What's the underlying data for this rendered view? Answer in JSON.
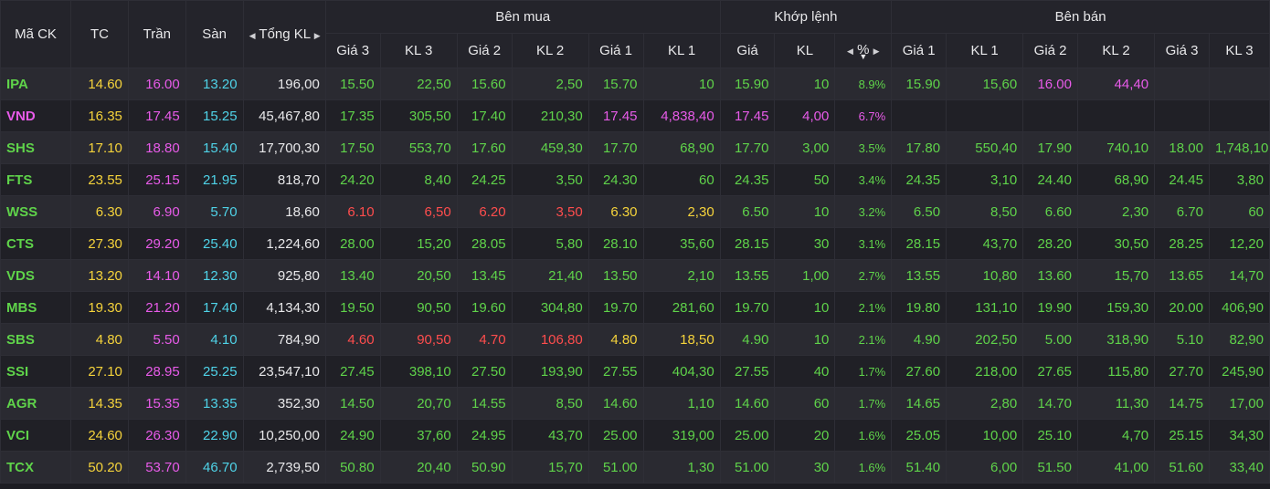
{
  "header": {
    "symbol": "Mã CK",
    "ref": "TC",
    "ceil": "Trần",
    "floor": "Sàn",
    "total_vol": "Tổng KL",
    "buy_group": "Bên mua",
    "match_group": "Khớp lệnh",
    "sell_group": "Bên bán",
    "buy_cols": [
      "Giá 3",
      "KL 3",
      "Giá 2",
      "KL 2",
      "Giá 1",
      "KL 1"
    ],
    "match_cols": [
      "Giá",
      "KL",
      "%"
    ],
    "sell_cols": [
      "Giá 1",
      "KL 1",
      "Giá 2",
      "KL 2",
      "Giá 3",
      "KL 3"
    ]
  },
  "colors": {
    "up": "#5fd34a",
    "down": "#ff4d4d",
    "ref": "#f5d33b",
    "ceil": "#e85be9",
    "floor": "#4fd3e8",
    "neutral": "#e8e8ea"
  },
  "rows": [
    {
      "s": "IPA",
      "tc": "14.60",
      "tran": "16.00",
      "san": "13.20",
      "tkl": "196,00",
      "cells": [
        [
          "15.50",
          "up"
        ],
        [
          "22,50",
          "up"
        ],
        [
          "15.60",
          "up"
        ],
        [
          "2,50",
          "up"
        ],
        [
          "15.70",
          "up"
        ],
        [
          "10",
          "up"
        ],
        [
          "15.90",
          "up"
        ],
        [
          "10",
          "up"
        ],
        [
          "8.9%",
          "up"
        ],
        [
          "15.90",
          "up"
        ],
        [
          "15,60",
          "up"
        ],
        [
          "16.00",
          "ceil"
        ],
        [
          "44,40",
          "ceil"
        ],
        [
          "",
          ""
        ],
        [
          "",
          ""
        ]
      ],
      "sc": "up"
    },
    {
      "s": "VND",
      "tc": "16.35",
      "tran": "17.45",
      "san": "15.25",
      "tkl": "45,467,80",
      "cells": [
        [
          "17.35",
          "up"
        ],
        [
          "305,50",
          "up"
        ],
        [
          "17.40",
          "up"
        ],
        [
          "210,30",
          "up"
        ],
        [
          "17.45",
          "ceil"
        ],
        [
          "4,838,40",
          "ceil"
        ],
        [
          "17.45",
          "ceil"
        ],
        [
          "4,00",
          "ceil"
        ],
        [
          "6.7%",
          "ceil"
        ],
        [
          "",
          ""
        ],
        [
          "",
          ""
        ],
        [
          "",
          ""
        ],
        [
          "",
          ""
        ],
        [
          "",
          ""
        ],
        [
          "",
          ""
        ]
      ],
      "sc": "ceil"
    },
    {
      "s": "SHS",
      "tc": "17.10",
      "tran": "18.80",
      "san": "15.40",
      "tkl": "17,700,30",
      "cells": [
        [
          "17.50",
          "up"
        ],
        [
          "553,70",
          "up"
        ],
        [
          "17.60",
          "up"
        ],
        [
          "459,30",
          "up"
        ],
        [
          "17.70",
          "up"
        ],
        [
          "68,90",
          "up"
        ],
        [
          "17.70",
          "up"
        ],
        [
          "3,00",
          "up"
        ],
        [
          "3.5%",
          "up"
        ],
        [
          "17.80",
          "up"
        ],
        [
          "550,40",
          "up"
        ],
        [
          "17.90",
          "up"
        ],
        [
          "740,10",
          "up"
        ],
        [
          "18.00",
          "up"
        ],
        [
          "1,748,10",
          "up"
        ]
      ],
      "sc": "up"
    },
    {
      "s": "FTS",
      "tc": "23.55",
      "tran": "25.15",
      "san": "21.95",
      "tkl": "818,70",
      "cells": [
        [
          "24.20",
          "up"
        ],
        [
          "8,40",
          "up"
        ],
        [
          "24.25",
          "up"
        ],
        [
          "3,50",
          "up"
        ],
        [
          "24.30",
          "up"
        ],
        [
          "60",
          "up"
        ],
        [
          "24.35",
          "up"
        ],
        [
          "50",
          "up"
        ],
        [
          "3.4%",
          "up"
        ],
        [
          "24.35",
          "up"
        ],
        [
          "3,10",
          "up"
        ],
        [
          "24.40",
          "up"
        ],
        [
          "68,90",
          "up"
        ],
        [
          "24.45",
          "up"
        ],
        [
          "3,80",
          "up"
        ]
      ],
      "sc": "up"
    },
    {
      "s": "WSS",
      "tc": "6.30",
      "tran": "6.90",
      "san": "5.70",
      "tkl": "18,60",
      "cells": [
        [
          "6.10",
          "down"
        ],
        [
          "6,50",
          "down"
        ],
        [
          "6.20",
          "down"
        ],
        [
          "3,50",
          "down"
        ],
        [
          "6.30",
          "ref"
        ],
        [
          "2,30",
          "ref"
        ],
        [
          "6.50",
          "up"
        ],
        [
          "10",
          "up"
        ],
        [
          "3.2%",
          "up"
        ],
        [
          "6.50",
          "up"
        ],
        [
          "8,50",
          "up"
        ],
        [
          "6.60",
          "up"
        ],
        [
          "2,30",
          "up"
        ],
        [
          "6.70",
          "up"
        ],
        [
          "60",
          "up"
        ]
      ],
      "sc": "up"
    },
    {
      "s": "CTS",
      "tc": "27.30",
      "tran": "29.20",
      "san": "25.40",
      "tkl": "1,224,60",
      "cells": [
        [
          "28.00",
          "up"
        ],
        [
          "15,20",
          "up"
        ],
        [
          "28.05",
          "up"
        ],
        [
          "5,80",
          "up"
        ],
        [
          "28.10",
          "up"
        ],
        [
          "35,60",
          "up"
        ],
        [
          "28.15",
          "up"
        ],
        [
          "30",
          "up"
        ],
        [
          "3.1%",
          "up"
        ],
        [
          "28.15",
          "up"
        ],
        [
          "43,70",
          "up"
        ],
        [
          "28.20",
          "up"
        ],
        [
          "30,50",
          "up"
        ],
        [
          "28.25",
          "up"
        ],
        [
          "12,20",
          "up"
        ]
      ],
      "sc": "up"
    },
    {
      "s": "VDS",
      "tc": "13.20",
      "tran": "14.10",
      "san": "12.30",
      "tkl": "925,80",
      "cells": [
        [
          "13.40",
          "up"
        ],
        [
          "20,50",
          "up"
        ],
        [
          "13.45",
          "up"
        ],
        [
          "21,40",
          "up"
        ],
        [
          "13.50",
          "up"
        ],
        [
          "2,10",
          "up"
        ],
        [
          "13.55",
          "up"
        ],
        [
          "1,00",
          "up"
        ],
        [
          "2.7%",
          "up"
        ],
        [
          "13.55",
          "up"
        ],
        [
          "10,80",
          "up"
        ],
        [
          "13.60",
          "up"
        ],
        [
          "15,70",
          "up"
        ],
        [
          "13.65",
          "up"
        ],
        [
          "14,70",
          "up"
        ]
      ],
      "sc": "up"
    },
    {
      "s": "MBS",
      "tc": "19.30",
      "tran": "21.20",
      "san": "17.40",
      "tkl": "4,134,30",
      "cells": [
        [
          "19.50",
          "up"
        ],
        [
          "90,50",
          "up"
        ],
        [
          "19.60",
          "up"
        ],
        [
          "304,80",
          "up"
        ],
        [
          "19.70",
          "up"
        ],
        [
          "281,60",
          "up"
        ],
        [
          "19.70",
          "up"
        ],
        [
          "10",
          "up"
        ],
        [
          "2.1%",
          "up"
        ],
        [
          "19.80",
          "up"
        ],
        [
          "131,10",
          "up"
        ],
        [
          "19.90",
          "up"
        ],
        [
          "159,30",
          "up"
        ],
        [
          "20.00",
          "up"
        ],
        [
          "406,90",
          "up"
        ]
      ],
      "sc": "up"
    },
    {
      "s": "SBS",
      "tc": "4.80",
      "tran": "5.50",
      "san": "4.10",
      "tkl": "784,90",
      "cells": [
        [
          "4.60",
          "down"
        ],
        [
          "90,50",
          "down"
        ],
        [
          "4.70",
          "down"
        ],
        [
          "106,80",
          "down"
        ],
        [
          "4.80",
          "ref"
        ],
        [
          "18,50",
          "ref"
        ],
        [
          "4.90",
          "up"
        ],
        [
          "10",
          "up"
        ],
        [
          "2.1%",
          "up"
        ],
        [
          "4.90",
          "up"
        ],
        [
          "202,50",
          "up"
        ],
        [
          "5.00",
          "up"
        ],
        [
          "318,90",
          "up"
        ],
        [
          "5.10",
          "up"
        ],
        [
          "82,90",
          "up"
        ]
      ],
      "sc": "up"
    },
    {
      "s": "SSI",
      "tc": "27.10",
      "tran": "28.95",
      "san": "25.25",
      "tkl": "23,547,10",
      "cells": [
        [
          "27.45",
          "up"
        ],
        [
          "398,10",
          "up"
        ],
        [
          "27.50",
          "up"
        ],
        [
          "193,90",
          "up"
        ],
        [
          "27.55",
          "up"
        ],
        [
          "404,30",
          "up"
        ],
        [
          "27.55",
          "up"
        ],
        [
          "40",
          "up"
        ],
        [
          "1.7%",
          "up"
        ],
        [
          "27.60",
          "up"
        ],
        [
          "218,00",
          "up"
        ],
        [
          "27.65",
          "up"
        ],
        [
          "115,80",
          "up"
        ],
        [
          "27.70",
          "up"
        ],
        [
          "245,90",
          "up"
        ]
      ],
      "sc": "up"
    },
    {
      "s": "AGR",
      "tc": "14.35",
      "tran": "15.35",
      "san": "13.35",
      "tkl": "352,30",
      "cells": [
        [
          "14.50",
          "up"
        ],
        [
          "20,70",
          "up"
        ],
        [
          "14.55",
          "up"
        ],
        [
          "8,50",
          "up"
        ],
        [
          "14.60",
          "up"
        ],
        [
          "1,10",
          "up"
        ],
        [
          "14.60",
          "up"
        ],
        [
          "60",
          "up"
        ],
        [
          "1.7%",
          "up"
        ],
        [
          "14.65",
          "up"
        ],
        [
          "2,80",
          "up"
        ],
        [
          "14.70",
          "up"
        ],
        [
          "11,30",
          "up"
        ],
        [
          "14.75",
          "up"
        ],
        [
          "17,00",
          "up"
        ]
      ],
      "sc": "up"
    },
    {
      "s": "VCI",
      "tc": "24.60",
      "tran": "26.30",
      "san": "22.90",
      "tkl": "10,250,00",
      "cells": [
        [
          "24.90",
          "up"
        ],
        [
          "37,60",
          "up"
        ],
        [
          "24.95",
          "up"
        ],
        [
          "43,70",
          "up"
        ],
        [
          "25.00",
          "up"
        ],
        [
          "319,00",
          "up"
        ],
        [
          "25.00",
          "up"
        ],
        [
          "20",
          "up"
        ],
        [
          "1.6%",
          "up"
        ],
        [
          "25.05",
          "up"
        ],
        [
          "10,00",
          "up"
        ],
        [
          "25.10",
          "up"
        ],
        [
          "4,70",
          "up"
        ],
        [
          "25.15",
          "up"
        ],
        [
          "34,30",
          "up"
        ]
      ],
      "sc": "up"
    },
    {
      "s": "TCX",
      "tc": "50.20",
      "tran": "53.70",
      "san": "46.70",
      "tkl": "2,739,50",
      "cells": [
        [
          "50.80",
          "up"
        ],
        [
          "20,40",
          "up"
        ],
        [
          "50.90",
          "up"
        ],
        [
          "15,70",
          "up"
        ],
        [
          "51.00",
          "up"
        ],
        [
          "1,30",
          "up"
        ],
        [
          "51.00",
          "up"
        ],
        [
          "30",
          "up"
        ],
        [
          "1.6%",
          "up"
        ],
        [
          "51.40",
          "up"
        ],
        [
          "6,00",
          "up"
        ],
        [
          "51.50",
          "up"
        ],
        [
          "41,00",
          "up"
        ],
        [
          "51.60",
          "up"
        ],
        [
          "33,40",
          "up"
        ]
      ],
      "sc": "up"
    }
  ]
}
